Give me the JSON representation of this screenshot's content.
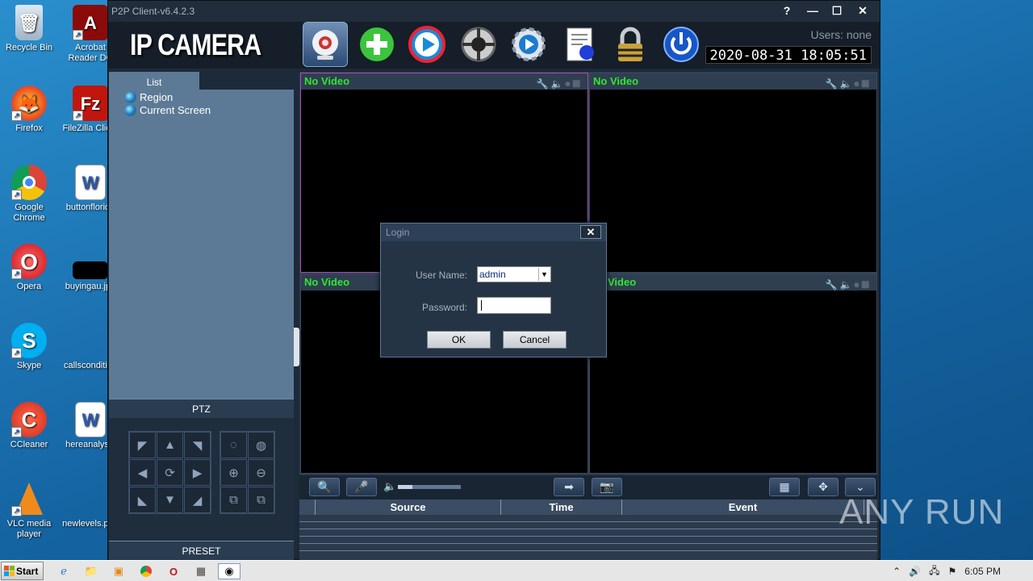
{
  "desktop": {
    "icons": [
      {
        "label": "Recycle Bin"
      },
      {
        "label": "Acrobat Reader DC"
      },
      {
        "label": "Firefox"
      },
      {
        "label": "FileZilla Client"
      },
      {
        "label": "Google Chrome"
      },
      {
        "label": "buttonflorida"
      },
      {
        "label": "Opera"
      },
      {
        "label": "buyingau.jpg"
      },
      {
        "label": "Skype"
      },
      {
        "label": "callscondition"
      },
      {
        "label": "CCleaner"
      },
      {
        "label": "hereanalysis"
      },
      {
        "label": "VLC media player"
      },
      {
        "label": "newlevels.png"
      }
    ]
  },
  "app": {
    "window_title": "P2P Client-v6.4.2.3",
    "logo": "IP CAMERA",
    "users": "Users: none",
    "datetime": "2020-08-31  18:05:51",
    "toolbar": [
      {
        "icon": "webcam-icon"
      },
      {
        "icon": "add-icon"
      },
      {
        "icon": "playback-icon"
      },
      {
        "icon": "ptz-control-icon"
      },
      {
        "icon": "settings-gear-icon"
      },
      {
        "icon": "log-document-icon"
      },
      {
        "icon": "lock-icon"
      },
      {
        "icon": "power-icon"
      }
    ],
    "left_panel": {
      "tab": "List",
      "tree": [
        "Region",
        "Current Screen"
      ],
      "ptz_header": "PTZ",
      "preset_header": "PRESET"
    },
    "video_cells": [
      {
        "label": "No Video"
      },
      {
        "label": "No Video"
      },
      {
        "label": "No Video"
      },
      {
        "label": "Video"
      }
    ],
    "event_table": {
      "columns": [
        "Source",
        "Time",
        "Event"
      ]
    }
  },
  "login_dialog": {
    "title": "Login",
    "username_label": "User Name:",
    "username_value": "admin",
    "password_label": "Password:",
    "password_value": "",
    "ok_label": "OK",
    "cancel_label": "Cancel",
    "close_glyph": "✕"
  },
  "taskbar": {
    "start_label": "Start",
    "clock": "6:05 PM"
  },
  "watermark": "ANY RUN"
}
